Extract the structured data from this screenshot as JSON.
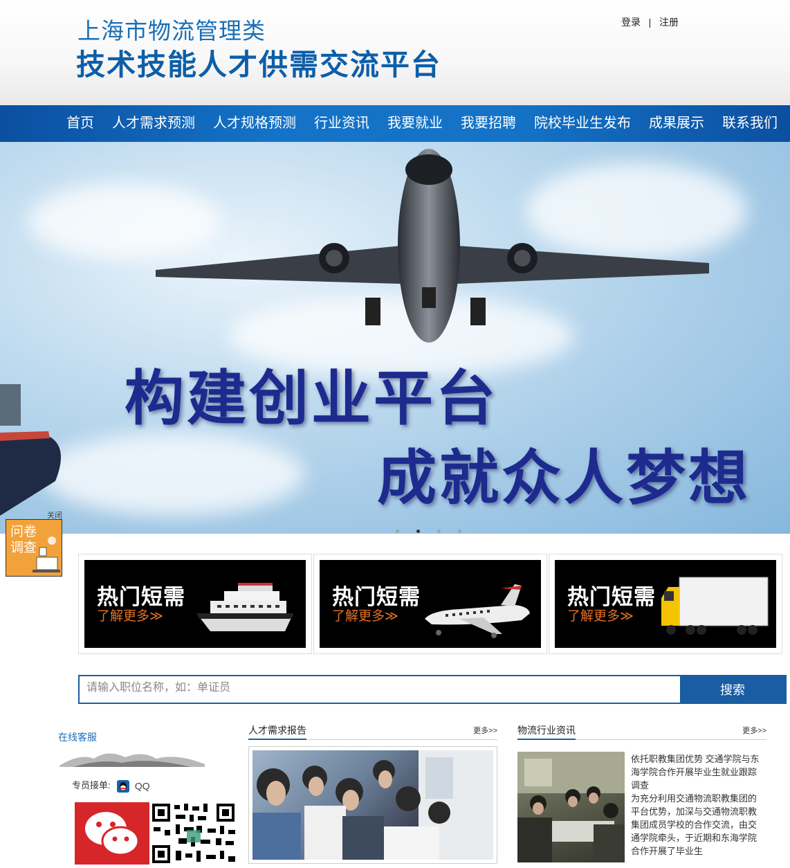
{
  "header": {
    "title_line1": "上海市物流管理类",
    "title_line2": "技术技能人才供需交流平台",
    "login": "登录",
    "separator": "|",
    "register": "注册"
  },
  "nav": {
    "items": [
      {
        "label": "首页"
      },
      {
        "label": "人才需求预测"
      },
      {
        "label": "人才规格预测"
      },
      {
        "label": "行业资讯"
      },
      {
        "label": "我要就业"
      },
      {
        "label": "我要招聘"
      },
      {
        "label": "院校毕业生发布"
      },
      {
        "label": "成果展示"
      },
      {
        "label": "联系我们"
      }
    ]
  },
  "banner": {
    "slogan_line1": "构建创业平台",
    "slogan_line2": "成就众人梦想",
    "slide_count": 4,
    "active_slide": 2
  },
  "survey": {
    "close_label": "关闭",
    "label": "问卷调查"
  },
  "cards": [
    {
      "title": "热门短需",
      "more": "了解更多≫",
      "art": "ship-icon"
    },
    {
      "title": "热门短需",
      "more": "了解更多≫",
      "art": "plane-icon"
    },
    {
      "title": "热门短需",
      "more": "了解更多≫",
      "art": "truck-icon"
    }
  ],
  "search": {
    "placeholder": "请输入职位名称，如：单证员",
    "button": "搜索"
  },
  "service": {
    "title": "在线客服",
    "contact_label": "专员接单:",
    "qq_label": "QQ"
  },
  "report": {
    "title": "人才需求报告",
    "more": "更多>>"
  },
  "news": {
    "title": "物流行业资讯",
    "more": "更多>>",
    "headline": "依托职教集团优势 交通学院与东海学院合作开展毕业生就业跟踪调查",
    "body": "为充分利用交通物流职教集团的平台优势，加深与交通物流职教集团成员学校的合作交流，由交通学院牵头，于近期和东海学院合作开展了毕业生"
  },
  "colors": {
    "brand_blue": "#1a5da2",
    "nav_blue": "#1473c7",
    "accent_orange": "#e37227",
    "survey_orange": "#f2a23a"
  }
}
